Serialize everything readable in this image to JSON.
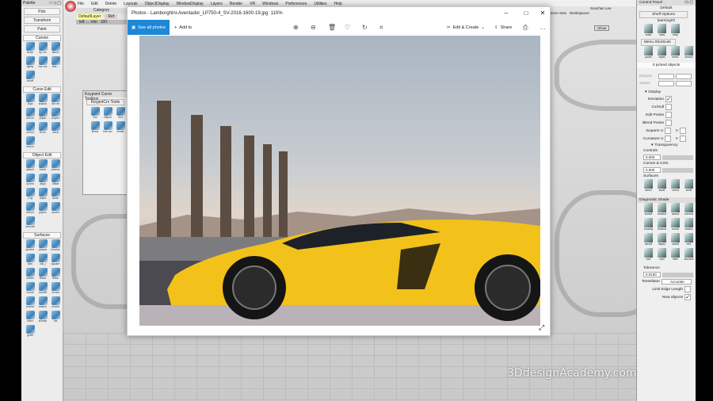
{
  "menubar": [
    "File",
    "Edit",
    "Delete",
    "Layouts",
    "ObjectDisplay",
    "WindowDisplay",
    "Layers",
    "Render",
    "VR",
    "Windows",
    "Preferences",
    "Utilities",
    "Help"
  ],
  "category": {
    "label": "Category",
    "layer": "DefaultLayer",
    "ref": "Ref",
    "left": "left ↔ mm",
    "value": "100"
  },
  "palette": {
    "title": "Palette",
    "buttons": [
      "Pick",
      "Transform",
      "Paint"
    ],
    "sections": [
      {
        "name": "Curves",
        "tools": [
          "circle",
          "ep crv",
          "blend",
          "lgeby",
          "nw cvs",
          "text...",
          "crvoff"
        ]
      },
      {
        "name": "Curve Edit",
        "tools": [
          "dupl",
          "snarch",
          "brk int",
          "rebcrv",
          "prjtan",
          "crvplnr",
          "crvext",
          "fit crv",
          "srfcrt",
          "rescrv"
        ]
      },
      {
        "name": "Object Edit",
        "tools": [
          "attach",
          "insert",
          "extend",
          "symm",
          "align",
          "offset",
          "t-rig",
          "objed",
          "close",
          "edcrvt",
          "pipecr",
          "spoed",
          "smooth"
        ]
      },
      {
        "name": "Surfaces",
        "tools": [
          "sphere",
          "planar",
          "revolve",
          "skin",
          "rail_i",
          "square",
          "srfillet",
          "ffblnd",
          "fflfan",
          "round",
          "msdrft",
          "crvnet",
          "crvbsrf",
          "ballcrv",
          "crvbld",
          "srtnn",
          "srfmsh",
          "xfs",
          "grdfll"
        ]
      }
    ]
  },
  "keypoint": {
    "title": "Keypoint Curve Toolbox",
    "tab": "KeypntCrv Tools",
    "tools": [
      "circ",
      "ellipse",
      "rect",
      "linear",
      "line-arc",
      "break"
    ]
  },
  "photos": {
    "title": "Photos - Lamborghini-Aventador_LP750-4_SV-2016-1600-19.jpg",
    "zoom": "110%",
    "see_all": "See all photos",
    "add_to": "Add to",
    "edit_create": "Edit & Create",
    "share": "Share"
  },
  "topright": {
    "user": "Soochan Lee",
    "sets": "ence Sets",
    "workspaces": "Workspaces",
    "show": "Show"
  },
  "control_panel": {
    "title": "Control Panel",
    "default": "Default",
    "shelf_options": "Shelf Options",
    "shelf_tab": "learning#2",
    "shelf_tools": [
      "eddc",
      "rules",
      "help"
    ],
    "menu_shortcuts": "Menu Shortcuts",
    "shortcut_tools": [
      "pullet",
      "objlst",
      "infwn",
      "drmod"
    ],
    "picked": "0 picked objects",
    "degree": "Degree",
    "spans": "Spans",
    "display": "Display",
    "display_rows": [
      {
        "label": "Deviation",
        "checked": true
      },
      {
        "label": "Cv/Hull",
        "checked": false
      },
      {
        "label": "Edit Points",
        "checked": false
      },
      {
        "label": "Blend Points",
        "checked": false
      }
    ],
    "isoparm": "Isoparm U",
    "curvature": "Curvature U",
    "v": "V",
    "transparency": "Transparency",
    "controls": "Controls",
    "controls_val": "0.000",
    "curves_cos": "Curves & COS",
    "curves_val": "0.000",
    "surfaces": "Surfaces",
    "surf_tools": [
      "clmcv",
      "sursf",
      "curva",
      "zedit"
    ],
    "diagnostic": "Diagnostic Shade",
    "diag_tools": [
      "shdoff",
      "multcol",
      "rancol",
      "curvcol",
      "isoang",
      "horizon",
      "curvsl",
      "zeatsc",
      "hzmel",
      "dayzo",
      "zebra",
      "vis1",
      "vis2",
      "vis3",
      "filter",
      "bormod"
    ],
    "tolerance": "Tolerance",
    "tolerance_val": "0.0100",
    "tessellator": "Tessellator",
    "tess_val": "Accurate",
    "limit_edge": "Limit Edge Length",
    "new_objects": "New objects"
  },
  "watermark": "3DdesignAcademy.com"
}
